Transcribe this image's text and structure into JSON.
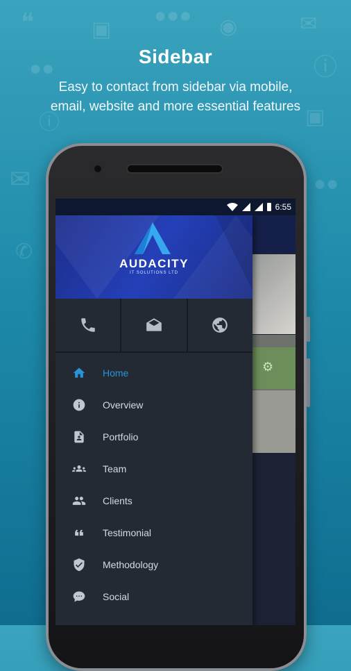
{
  "headline": "Sidebar",
  "subline_lines": [
    "Easy to contact from sidebar via mobile,",
    "email, website and more essential features"
  ],
  "status_bar": {
    "time": "6:55"
  },
  "brand": {
    "name": "AUDACITY",
    "tagline": "IT SOLUTIONS LTD"
  },
  "contact_actions": [
    {
      "icon": "phone-icon"
    },
    {
      "icon": "mail-icon"
    },
    {
      "icon": "globe-icon"
    }
  ],
  "menu": [
    {
      "label": "Home",
      "icon": "home-icon",
      "active": true
    },
    {
      "label": "Overview",
      "icon": "info-icon"
    },
    {
      "label": "Portfolio",
      "icon": "document-icon"
    },
    {
      "label": "Team",
      "icon": "team-icon"
    },
    {
      "label": "Clients",
      "icon": "clients-icon"
    },
    {
      "label": "Testimonial",
      "icon": "quote-icon"
    },
    {
      "label": "Methodology",
      "icon": "shield-check-icon"
    },
    {
      "label": "Social",
      "icon": "chat-icon"
    }
  ],
  "colors": {
    "accent": "#2a93d8",
    "drawer": "#242a33",
    "header": "#2440b8"
  }
}
